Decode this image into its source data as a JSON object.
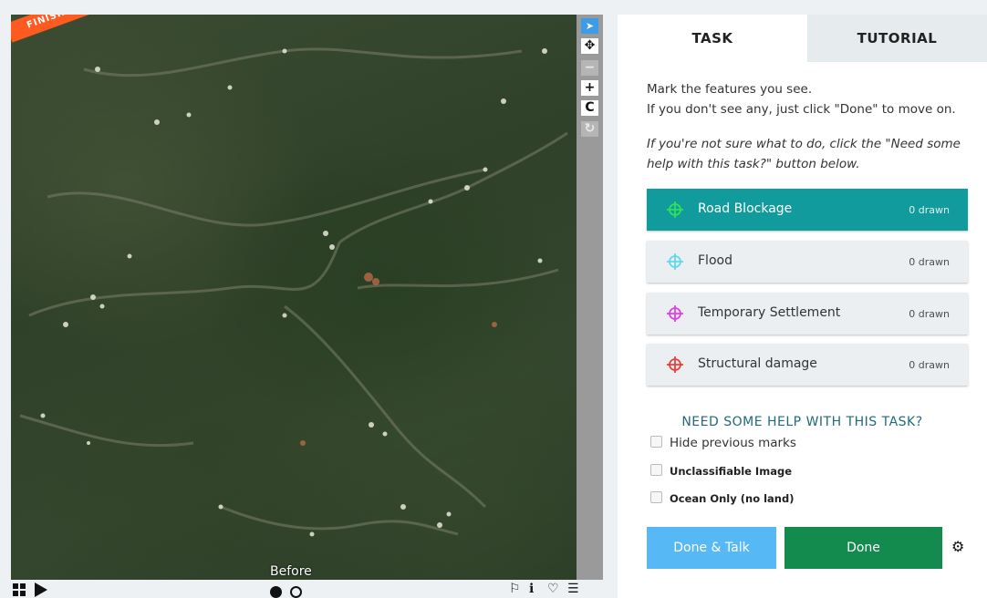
{
  "viewer": {
    "ribbon": "FINISHED!",
    "frame_label": "Before",
    "tools": [
      {
        "name": "pointer-tool",
        "glyph": "➤",
        "state": "active"
      },
      {
        "name": "pan-tool",
        "glyph": "✥",
        "state": "normal"
      },
      {
        "name": "zoom-out-tool",
        "glyph": "−",
        "state": "disabled"
      },
      {
        "name": "zoom-in-tool",
        "glyph": "+",
        "state": "normal"
      },
      {
        "name": "rotate-tool",
        "glyph": "C",
        "state": "normal"
      },
      {
        "name": "reset-tool",
        "glyph": "↻",
        "state": "disabled"
      }
    ],
    "bottom_icons": {
      "flag": "⚐",
      "info": "ℹ",
      "heart": "♡",
      "collections": "☰"
    }
  },
  "panel": {
    "tabs": {
      "task": "TASK",
      "tutorial": "TUTORIAL"
    },
    "instructions": [
      "Mark the features you see.",
      "If you don't see any, just click \"Done\" to move on."
    ],
    "hint": "If you're not sure what to do, click the \"Need some help with this task?\" button below.",
    "tools": [
      {
        "label": "Road Blockage",
        "count": "0 drawn",
        "color": "#2ee05a",
        "selected": true
      },
      {
        "label": "Flood",
        "count": "0 drawn",
        "color": "#5fd8f0",
        "selected": false
      },
      {
        "label": "Temporary Settlement",
        "count": "0 drawn",
        "color": "#e040e8",
        "selected": false
      },
      {
        "label": "Structural damage",
        "count": "0 drawn",
        "color": "#e8413a",
        "selected": false
      }
    ],
    "help_heading": "NEED SOME HELP WITH THIS TASK?",
    "hide_marks": "Hide previous marks",
    "unclassifiable": "Unclassifiable Image",
    "ocean_only": "Ocean Only (no land)",
    "done_talk": "Done & Talk",
    "done": "Done"
  }
}
